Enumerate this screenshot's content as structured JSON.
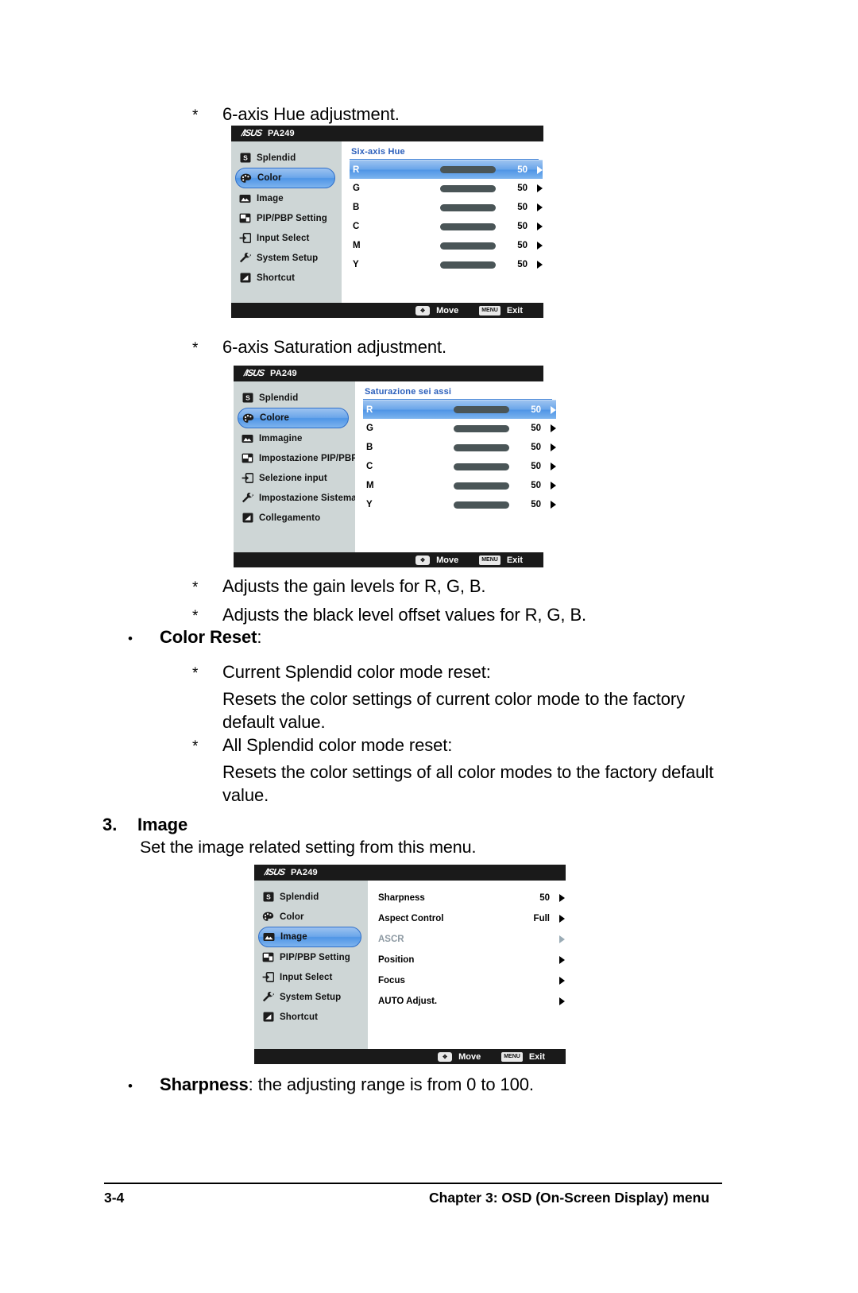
{
  "page": {
    "number": "3-4",
    "footer_title": "Chapter 3: OSD (On-Screen Display) menu"
  },
  "lines": {
    "hue_caption": "6-axis Hue adjustment.",
    "sat_caption": "6-axis Saturation adjustment.",
    "gain": "Adjusts the gain levels for R, G, B.",
    "black_level": "Adjusts the black level offset values for R, G, B.",
    "color_reset_label": "Color Reset",
    "color_reset_colon": ":",
    "current_reset_title": "Current Splendid color mode reset:",
    "current_reset_body": "Resets the color settings of current color mode to the factory default value.",
    "all_reset_title": "All Splendid color mode reset:",
    "all_reset_body": "Resets the color settings of all color modes to the factory default value.",
    "section_number": "3.",
    "section_title": "Image",
    "section_body": "Set the image related setting from this menu.",
    "sharpness_bold": "Sharpness",
    "sharpness_rest": ": the adjusting range is from 0 to 100.",
    "star": "*",
    "bullet": "•"
  },
  "osd_common": {
    "brand": "/ISUS",
    "model": "PA249",
    "footer": {
      "move_key": "✥",
      "move_label": "Move",
      "menu_key": "MENU",
      "exit_label": "Exit"
    }
  },
  "osd_hue": {
    "menu": [
      {
        "label": "Splendid",
        "icon": "splendid-icon",
        "selected": false
      },
      {
        "label": "Color",
        "icon": "color-palette-icon",
        "selected": true
      },
      {
        "label": "Image",
        "icon": "image-icon",
        "selected": false
      },
      {
        "label": "PIP/PBP Setting",
        "icon": "pip-pbp-icon",
        "selected": false
      },
      {
        "label": "Input Select",
        "icon": "input-select-icon",
        "selected": false
      },
      {
        "label": "System Setup",
        "icon": "wrench-icon",
        "selected": false
      },
      {
        "label": "Shortcut",
        "icon": "shortcut-icon",
        "selected": false
      }
    ],
    "panel_title": "Six-axis Hue",
    "sliders": [
      {
        "label": "R",
        "value": "50",
        "color": "#ee1b17",
        "selected": true
      },
      {
        "label": "G",
        "value": "50",
        "color": "#3ee61a",
        "selected": false
      },
      {
        "label": "B",
        "value": "50",
        "color": "#2030dd",
        "selected": false
      },
      {
        "label": "C",
        "value": "50",
        "color": "#7ef2dc",
        "selected": false
      },
      {
        "label": "M",
        "value": "50",
        "color": "#c255f0",
        "selected": false
      },
      {
        "label": "Y",
        "value": "50",
        "color": "#f2ee1e",
        "selected": false
      }
    ]
  },
  "osd_sat": {
    "menu": [
      {
        "label": "Splendid",
        "icon": "splendid-icon",
        "selected": false
      },
      {
        "label": "Colore",
        "icon": "color-palette-icon",
        "selected": true
      },
      {
        "label": "Immagine",
        "icon": "image-icon",
        "selected": false
      },
      {
        "label": "Impostazione PIP/PBP",
        "icon": "pip-pbp-icon",
        "selected": false
      },
      {
        "label": "Selezione input",
        "icon": "input-select-icon",
        "selected": false
      },
      {
        "label": "Impostazione Sistema",
        "icon": "wrench-icon",
        "selected": false
      },
      {
        "label": "Collegamento",
        "icon": "shortcut-icon",
        "selected": false
      }
    ],
    "panel_title": "Saturazione sei assi",
    "sliders": [
      {
        "label": "R",
        "value": "50",
        "color": "#ee1b17",
        "selected": true
      },
      {
        "label": "G",
        "value": "50",
        "color": "#3ee61a",
        "selected": false
      },
      {
        "label": "B",
        "value": "50",
        "color": "#2030dd",
        "selected": false
      },
      {
        "label": "C",
        "value": "50",
        "color": "#7ef2dc",
        "selected": false
      },
      {
        "label": "M",
        "value": "50",
        "color": "#c255f0",
        "selected": false
      },
      {
        "label": "Y",
        "value": "50",
        "color": "#f2ee1e",
        "selected": false
      }
    ]
  },
  "osd_image": {
    "menu": [
      {
        "label": "Splendid",
        "icon": "splendid-icon",
        "selected": false
      },
      {
        "label": "Color",
        "icon": "color-palette-icon",
        "selected": false
      },
      {
        "label": "Image",
        "icon": "image-icon",
        "selected": true
      },
      {
        "label": "PIP/PBP Setting",
        "icon": "pip-pbp-icon",
        "selected": false
      },
      {
        "label": "Input Select",
        "icon": "input-select-icon",
        "selected": false
      },
      {
        "label": "System Setup",
        "icon": "wrench-icon",
        "selected": false
      },
      {
        "label": "Shortcut",
        "icon": "shortcut-icon",
        "selected": false
      }
    ],
    "options": [
      {
        "label": "Sharpness",
        "value": "50",
        "disabled": false
      },
      {
        "label": "Aspect Control",
        "value": "Full",
        "disabled": false
      },
      {
        "label": "ASCR",
        "value": "",
        "disabled": true
      },
      {
        "label": "Position",
        "value": "",
        "disabled": false
      },
      {
        "label": "Focus",
        "value": "",
        "disabled": false
      },
      {
        "label": "AUTO Adjust.",
        "value": "",
        "disabled": false
      }
    ]
  },
  "colors": {
    "menu_bg": "#ced6d6",
    "selected_blue": "#4f95e6",
    "panel_title_blue": "#2b5fbb",
    "titlebar": "#1a1a1a"
  }
}
